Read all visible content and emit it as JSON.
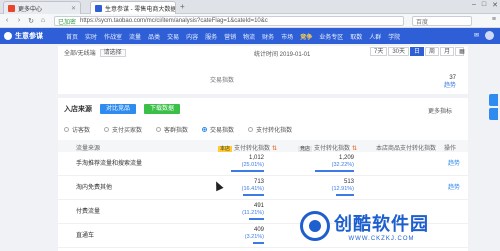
{
  "browser": {
    "tabs": [
      {
        "title": "更多中心",
        "active": false
      },
      {
        "title": "生意参谋 - 零售电商大数据...",
        "active": true
      }
    ],
    "url": "https://sycm.taobao.com/mc/ci/item/analysis?cateFlag=1&cateId=10&c",
    "secure_label": "已加密",
    "search_engine": "百度"
  },
  "site_nav": {
    "logo": "生意参谋",
    "items": [
      "首页",
      "实时",
      "作战室",
      "流量",
      "品类",
      "交易",
      "内容",
      "服务",
      "营销",
      "物流",
      "财务",
      "市场",
      "竞争",
      "业务专区",
      "取数",
      "人群",
      "学院"
    ],
    "active_item": "竞争"
  },
  "top_card": {
    "filter_label": "全部/无线端",
    "filter_value": "请选择",
    "stat_time": "统计时间 2019-01-01",
    "periods": [
      "7天",
      "30天",
      "日",
      "周",
      "月"
    ],
    "selected_period": "日",
    "metric_label": "交易指数",
    "metric_value": "37",
    "metric_trend": "趋势"
  },
  "main_card": {
    "title": "入店来源",
    "btn_compare": "对比竞品",
    "btn_export": "下载数据",
    "more_label": "更多指标",
    "subtabs": [
      {
        "label": "访客数",
        "on": false
      },
      {
        "label": "支付买家数",
        "on": false
      },
      {
        "label": "客群指数",
        "on": false
      },
      {
        "label": "交易指数",
        "on": true
      },
      {
        "label": "支付转化指数",
        "on": false
      }
    ],
    "headers": {
      "source": "流量来源",
      "col1_tag": "本店",
      "col1": "支付转化指数",
      "col2_tag": "竞店",
      "col2": "支付转化指数",
      "col3": "本店商品支付转化指数",
      "op": "操作"
    },
    "rows": [
      {
        "name": "手淘推荐流量和搜索流量",
        "v1": "1,012",
        "p1": "(25.01%)",
        "f1": 0.55,
        "v2": "1,209",
        "p2": "(32.22%)",
        "f2": 0.65,
        "op": "趋势"
      },
      {
        "name": "淘内免费其他",
        "v1": "713",
        "p1": "(16.41%)",
        "f1": 0.35,
        "v2": "513",
        "p2": "(12.91%)",
        "f2": 0.3,
        "op": "趋势"
      },
      {
        "name": "付费流量",
        "v1": "491",
        "p1": "(11.21%)",
        "f1": 0.25,
        "v2": "",
        "p2": "",
        "f2": 0,
        "op": ""
      },
      {
        "name": "直通车",
        "v1": "409",
        "p1": "(3.21%)",
        "f1": 0.18,
        "v2": "",
        "p2": "",
        "f2": 0,
        "op": ""
      }
    ]
  },
  "watermark": {
    "title": "创酷软件园",
    "url": "WWW.CKZKJ.COM"
  },
  "colors": {
    "nav_blue": "#2e5fd6",
    "accent_blue": "#2e8bef",
    "accent_green": "#3bbf47",
    "tag_yellow": "#ffcc33"
  }
}
